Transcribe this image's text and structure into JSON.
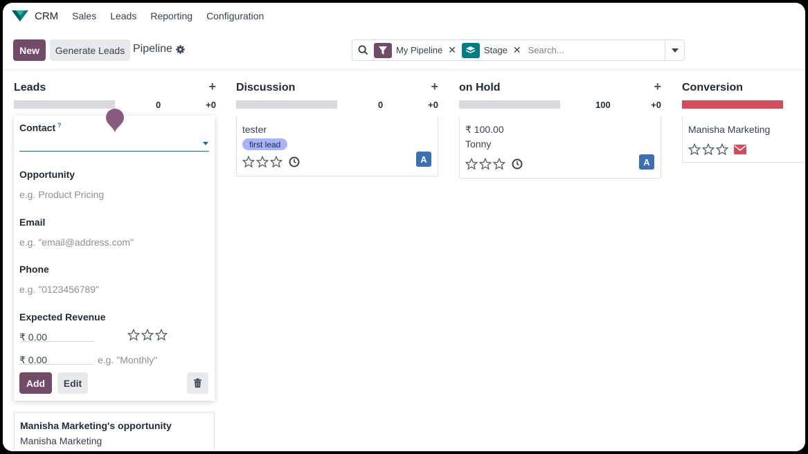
{
  "nav": {
    "app_name": "CRM",
    "menu": [
      "Sales",
      "Leads",
      "Reporting",
      "Configuration"
    ]
  },
  "control": {
    "new_label": "New",
    "generate_label": "Generate Leads",
    "breadcrumb": "Pipeline",
    "facets": [
      {
        "label": "My Pipeline",
        "icon": "filter-icon",
        "color": "#714b67"
      },
      {
        "label": "Stage",
        "icon": "layers-icon",
        "color": "#017e84"
      }
    ],
    "search_placeholder": "Search..."
  },
  "columns": [
    {
      "title": "Leads",
      "sum": "0",
      "count": "+0"
    },
    {
      "title": "Discussion",
      "sum": "0",
      "count": "+0"
    },
    {
      "title": "on Hold",
      "sum": "100",
      "count": "+0"
    },
    {
      "title": "Conversion",
      "sum": "",
      "count": "",
      "bar_color": "#d44c59"
    }
  ],
  "quick_create": {
    "contact_label": "Contact",
    "contact_help": "?",
    "opportunity_label": "Opportunity",
    "opportunity_placeholder": "e.g. Product Pricing",
    "email_label": "Email",
    "email_placeholder": "e.g. \"email@address.com\"",
    "phone_label": "Phone",
    "phone_placeholder": "e.g. \"0123456789\"",
    "revenue_label": "Expected Revenue",
    "revenue_value": "₹ 0.00",
    "recurring_value": "₹ 0.00",
    "recurring_placeholder": "e.g. \"Monthly\"",
    "add_label": "Add",
    "edit_label": "Edit"
  },
  "cards": {
    "leads_card": {
      "title": "Manisha Marketing's opportunity",
      "customer": "Manisha Marketing"
    },
    "discussion_card": {
      "customer": "tester",
      "tag": "first lead",
      "avatar": "A"
    },
    "hold_card": {
      "revenue": "₹ 100.00",
      "customer": "Tonny",
      "avatar": "A"
    },
    "conversion_card": {
      "customer": "Manisha Marketing"
    }
  },
  "colors": {
    "primary": "#714b67",
    "avatar": "#3b6fb6",
    "danger": "#d44c59"
  }
}
